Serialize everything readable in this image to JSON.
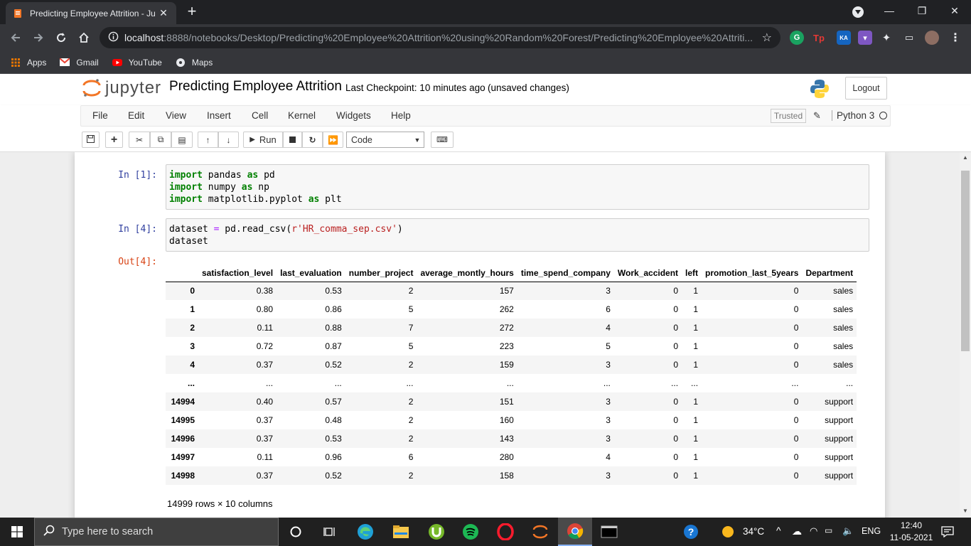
{
  "browser": {
    "tab_title": "Predicting Employee Attrition - Ju",
    "new_tab_symbol": "+",
    "url_host": "localhost",
    "url_rest": ":8888/notebooks/Desktop/Predicting%20Employee%20Attrition%20using%20Random%20Forest/Predicting%20Employee%20Attriti...",
    "bookmarks": [
      {
        "label": "Apps",
        "icon": "apps-grid-icon"
      },
      {
        "label": "Gmail",
        "icon": "gmail-icon"
      },
      {
        "label": "YouTube",
        "icon": "youtube-icon"
      },
      {
        "label": "Maps",
        "icon": "maps-icon"
      }
    ]
  },
  "jupyter": {
    "logo_text": "jupyter",
    "notebook_name": "Predicting Employee Attrition",
    "checkpoint": "Last Checkpoint: 10 minutes ago",
    "unsaved": "(unsaved changes)",
    "logout_label": "Logout",
    "menu": [
      "File",
      "Edit",
      "View",
      "Insert",
      "Cell",
      "Kernel",
      "Widgets",
      "Help"
    ],
    "trusted_label": "Trusted",
    "kernel_name": "Python 3",
    "run_label": "Run",
    "cell_type": "Code"
  },
  "cells": {
    "in1_prompt": "In [1]:",
    "in4_prompt": "In [4]:",
    "out4_prompt": "Out[4]:",
    "shape_text": "14999 rows × 10 columns"
  },
  "dataframe": {
    "columns": [
      "",
      "satisfaction_level",
      "last_evaluation",
      "number_project",
      "average_montly_hours",
      "time_spend_company",
      "Work_accident",
      "left",
      "promotion_last_5years",
      "Department"
    ],
    "rows": [
      [
        "0",
        "0.38",
        "0.53",
        "2",
        "157",
        "3",
        "0",
        "1",
        "0",
        "sales"
      ],
      [
        "1",
        "0.80",
        "0.86",
        "5",
        "262",
        "6",
        "0",
        "1",
        "0",
        "sales"
      ],
      [
        "2",
        "0.11",
        "0.88",
        "7",
        "272",
        "4",
        "0",
        "1",
        "0",
        "sales"
      ],
      [
        "3",
        "0.72",
        "0.87",
        "5",
        "223",
        "5",
        "0",
        "1",
        "0",
        "sales"
      ],
      [
        "4",
        "0.37",
        "0.52",
        "2",
        "159",
        "3",
        "0",
        "1",
        "0",
        "sales"
      ],
      [
        "...",
        "...",
        "...",
        "...",
        "...",
        "...",
        "...",
        "...",
        "...",
        "..."
      ],
      [
        "14994",
        "0.40",
        "0.57",
        "2",
        "151",
        "3",
        "0",
        "1",
        "0",
        "support"
      ],
      [
        "14995",
        "0.37",
        "0.48",
        "2",
        "160",
        "3",
        "0",
        "1",
        "0",
        "support"
      ],
      [
        "14996",
        "0.37",
        "0.53",
        "2",
        "143",
        "3",
        "0",
        "1",
        "0",
        "support"
      ],
      [
        "14997",
        "0.11",
        "0.96",
        "6",
        "280",
        "4",
        "0",
        "1",
        "0",
        "support"
      ],
      [
        "14998",
        "0.37",
        "0.52",
        "2",
        "158",
        "3",
        "0",
        "1",
        "0",
        "support"
      ]
    ]
  },
  "taskbar": {
    "search_placeholder": "Type here to search",
    "temperature": "34°C",
    "language": "ENG",
    "time": "12:40",
    "date": "11-05-2021"
  }
}
